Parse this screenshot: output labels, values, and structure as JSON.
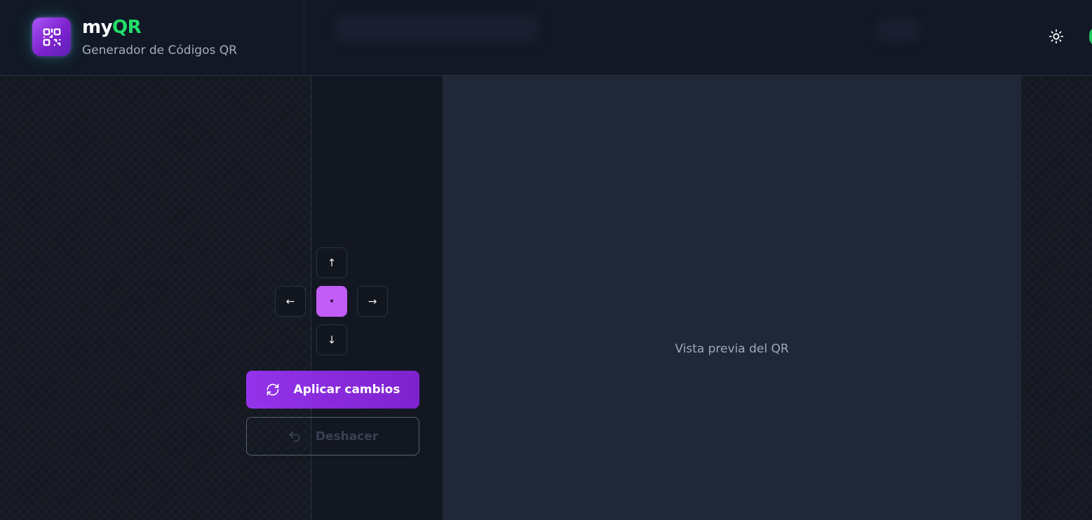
{
  "header": {
    "brand_prefix": "my",
    "brand_suffix": "QR",
    "subtitle": "Generador de Códigos QR",
    "logo_icon": "qr-code-icon",
    "theme_icon": "sun-icon"
  },
  "dpad": {
    "up": "↑",
    "down": "↓",
    "left": "←",
    "right": "→",
    "center": "•"
  },
  "actions": {
    "apply_label": "Aplicar cambios",
    "apply_icon": "refresh-icon",
    "undo_label": "Deshacer",
    "undo_icon": "undo-icon"
  },
  "preview": {
    "placeholder": "Vista previa del QR"
  },
  "colors": {
    "accent_purple": "#9333ea",
    "brand_green": "#22e06a",
    "preview_bg": "#202838"
  }
}
